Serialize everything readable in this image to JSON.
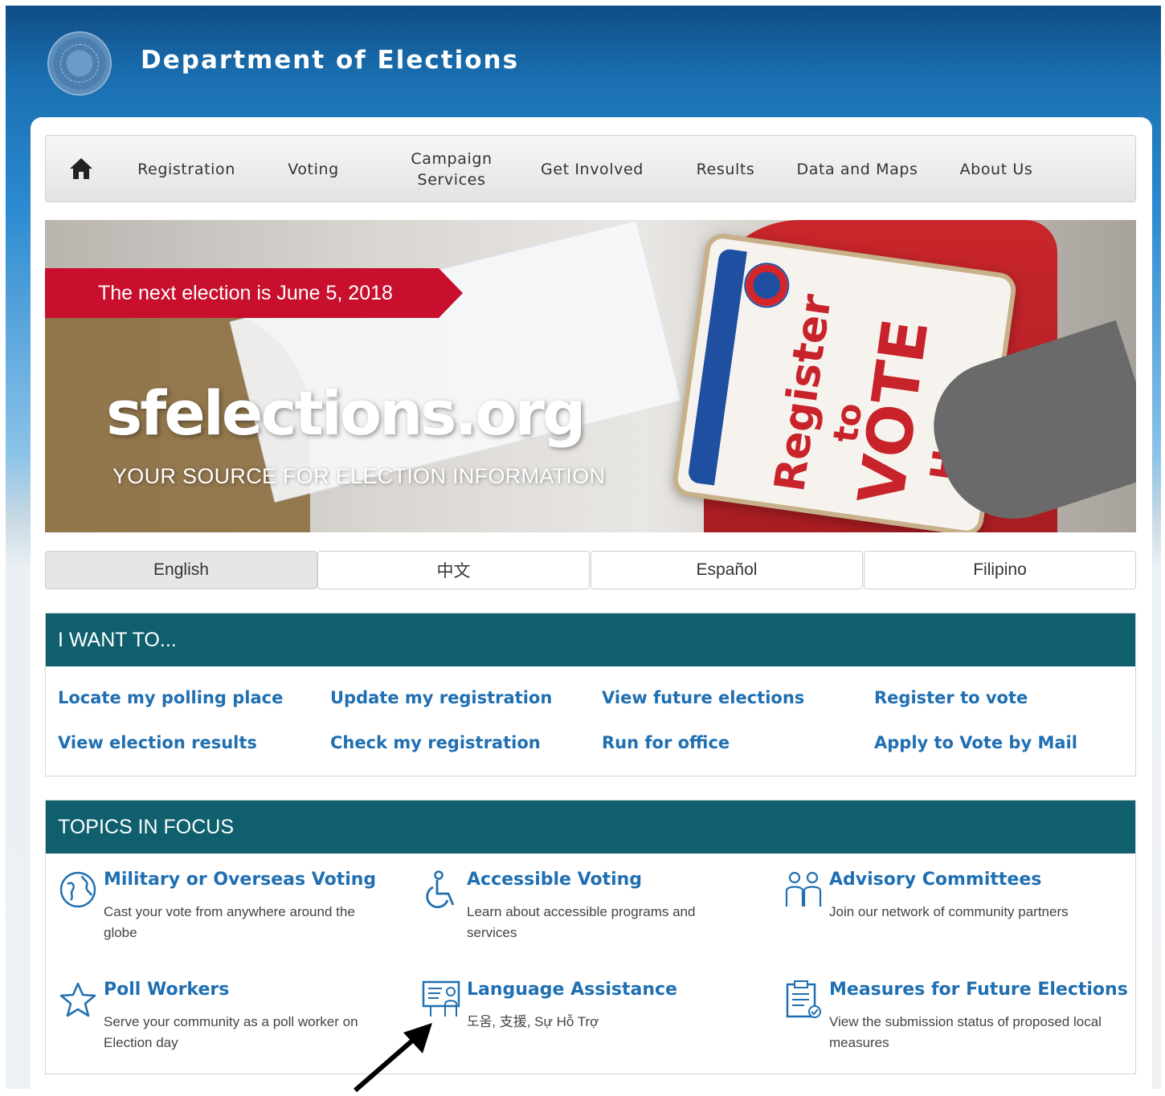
{
  "header": {
    "title": "Department of Elections"
  },
  "nav": {
    "items": [
      {
        "label": "Registration"
      },
      {
        "label": "Voting"
      },
      {
        "label": "Campaign Services"
      },
      {
        "label": "Get Involved"
      },
      {
        "label": "Results"
      },
      {
        "label": "Data and Maps"
      },
      {
        "label": "About Us"
      }
    ]
  },
  "hero": {
    "banner": "The next election is June 5, 2018",
    "domain": "sfelections.org",
    "tagline": "YOUR SOURCE FOR ELECTION INFORMATION",
    "sign": {
      "line1": "Register",
      "line2": "to",
      "line3": "VOTE",
      "line4": "Here"
    }
  },
  "languages": [
    {
      "label": "English",
      "active": true
    },
    {
      "label": "中文",
      "active": false
    },
    {
      "label": "Español",
      "active": false
    },
    {
      "label": "Filipino",
      "active": false
    }
  ],
  "i_want_to": {
    "heading": "I WANT TO...",
    "links": [
      "Locate my polling place",
      "Update my registration",
      "View future elections",
      "Register to vote",
      "View election results",
      "Check my registration",
      "Run for office",
      "Apply to Vote by Mail"
    ]
  },
  "topics": {
    "heading": "TOPICS IN FOCUS",
    "items": [
      {
        "title": "Military or Overseas Voting",
        "desc": "Cast your vote from anywhere around the globe",
        "icon": "globe-icon"
      },
      {
        "title": "Accessible Voting",
        "desc": "Learn about accessible programs and services",
        "icon": "wheelchair-icon"
      },
      {
        "title": "Advisory Committees",
        "desc": "Join our network of community partners",
        "icon": "people-icon"
      },
      {
        "title": "Poll Workers",
        "desc": "Serve your community as a poll worker on Election day",
        "icon": "star-icon"
      },
      {
        "title": "Language Assistance",
        "desc": "도움, 支援, Sự Hỗ Trợ",
        "icon": "presentation-icon"
      },
      {
        "title": "Measures for Future Elections",
        "desc": "View the submission status of proposed local measures",
        "icon": "clipboard-icon"
      }
    ]
  },
  "colors": {
    "header_blue": "#0f4d86",
    "panel_teal": "#0f5f6e",
    "link_blue": "#1f6fb2",
    "banner_red": "#c8102e"
  }
}
